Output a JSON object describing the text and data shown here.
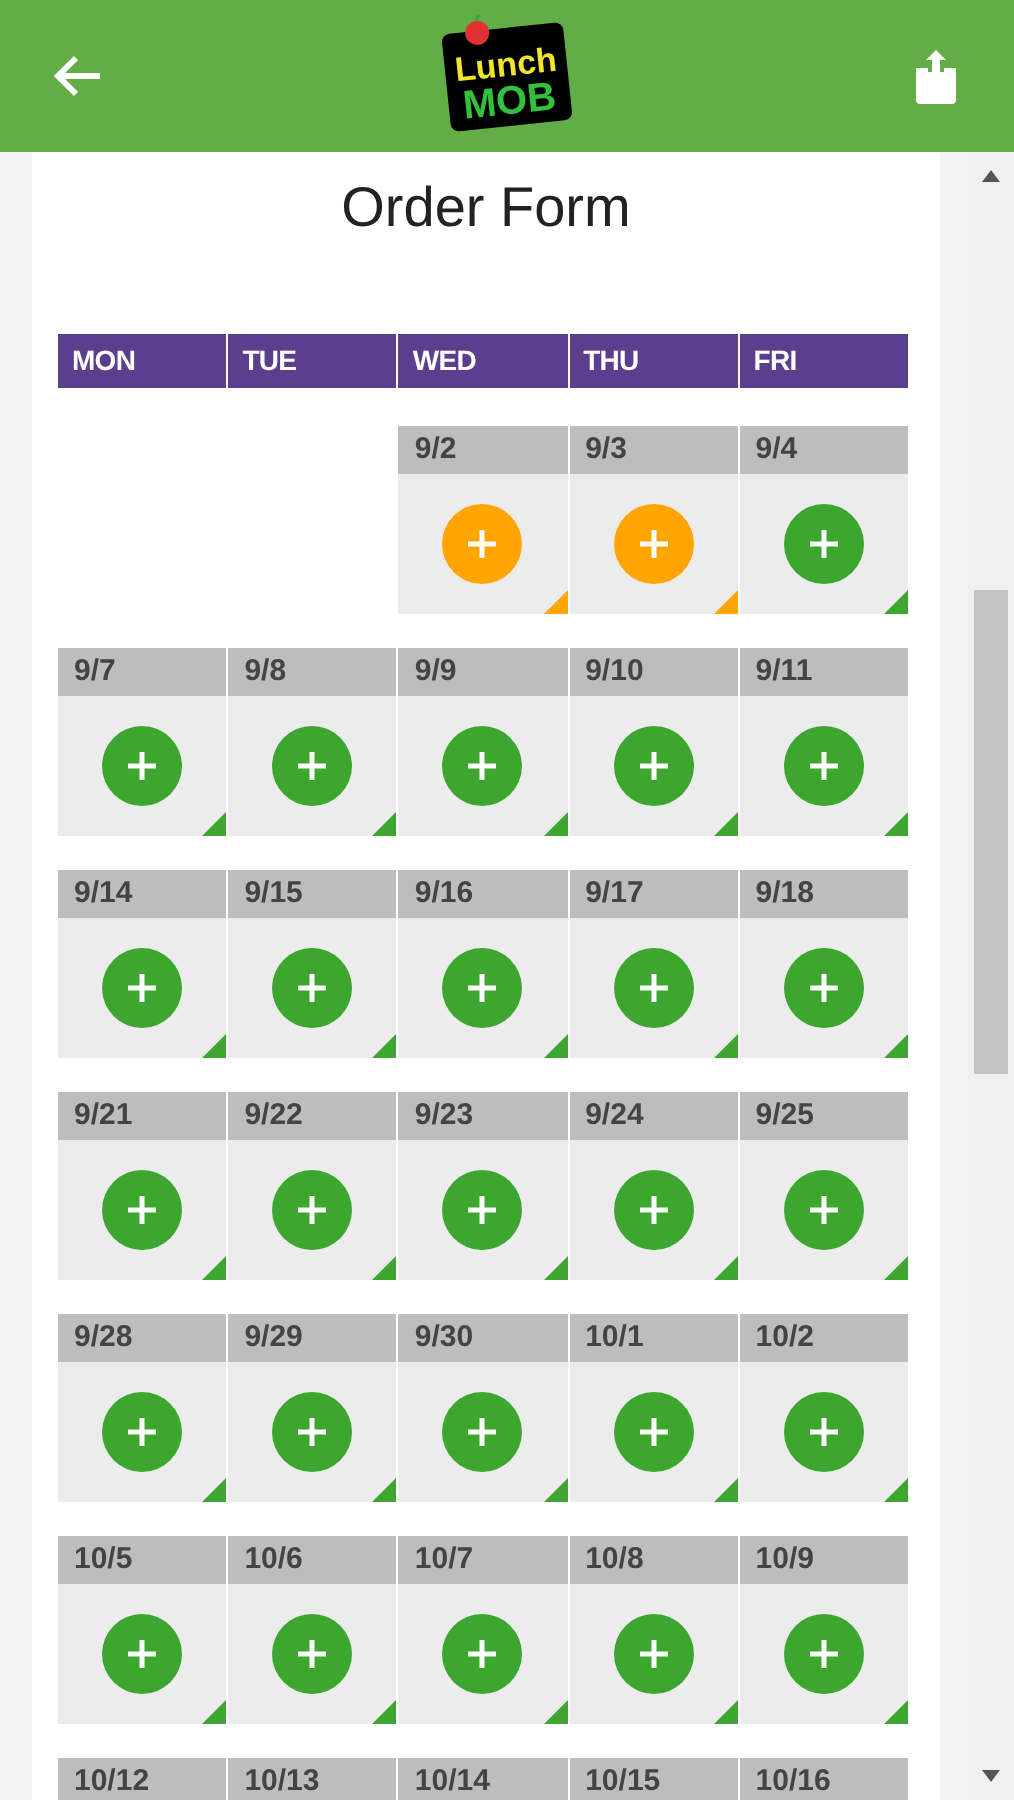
{
  "header": {
    "logo_top": "Lunch",
    "logo_bottom": "MOB"
  },
  "title": "Order Form",
  "weekdays": [
    "MON",
    "TUE",
    "WED",
    "THU",
    "FRI"
  ],
  "weeks": [
    {
      "days": [
        {
          "kind": "empty"
        },
        {
          "kind": "empty"
        },
        {
          "kind": "day",
          "date": "9/2",
          "color": "#ffa500"
        },
        {
          "kind": "day",
          "date": "9/3",
          "color": "#ffa500"
        },
        {
          "kind": "day",
          "date": "9/4",
          "color": "#3da62e"
        }
      ]
    },
    {
      "days": [
        {
          "kind": "day",
          "date": "9/7",
          "color": "#3da62e"
        },
        {
          "kind": "day",
          "date": "9/8",
          "color": "#3da62e"
        },
        {
          "kind": "day",
          "date": "9/9",
          "color": "#3da62e"
        },
        {
          "kind": "day",
          "date": "9/10",
          "color": "#3da62e"
        },
        {
          "kind": "day",
          "date": "9/11",
          "color": "#3da62e"
        }
      ]
    },
    {
      "days": [
        {
          "kind": "day",
          "date": "9/14",
          "color": "#3da62e"
        },
        {
          "kind": "day",
          "date": "9/15",
          "color": "#3da62e"
        },
        {
          "kind": "day",
          "date": "9/16",
          "color": "#3da62e"
        },
        {
          "kind": "day",
          "date": "9/17",
          "color": "#3da62e"
        },
        {
          "kind": "day",
          "date": "9/18",
          "color": "#3da62e"
        }
      ]
    },
    {
      "days": [
        {
          "kind": "day",
          "date": "9/21",
          "color": "#3da62e"
        },
        {
          "kind": "day",
          "date": "9/22",
          "color": "#3da62e"
        },
        {
          "kind": "day",
          "date": "9/23",
          "color": "#3da62e"
        },
        {
          "kind": "day",
          "date": "9/24",
          "color": "#3da62e"
        },
        {
          "kind": "day",
          "date": "9/25",
          "color": "#3da62e"
        }
      ]
    },
    {
      "days": [
        {
          "kind": "day",
          "date": "9/28",
          "color": "#3da62e"
        },
        {
          "kind": "day",
          "date": "9/29",
          "color": "#3da62e"
        },
        {
          "kind": "day",
          "date": "9/30",
          "color": "#3da62e"
        },
        {
          "kind": "day",
          "date": "10/1",
          "color": "#3da62e"
        },
        {
          "kind": "day",
          "date": "10/2",
          "color": "#3da62e"
        }
      ]
    },
    {
      "days": [
        {
          "kind": "day",
          "date": "10/5",
          "color": "#3da62e"
        },
        {
          "kind": "day",
          "date": "10/6",
          "color": "#3da62e"
        },
        {
          "kind": "day",
          "date": "10/7",
          "color": "#3da62e"
        },
        {
          "kind": "day",
          "date": "10/8",
          "color": "#3da62e"
        },
        {
          "kind": "day",
          "date": "10/9",
          "color": "#3da62e"
        }
      ]
    },
    {
      "days": [
        {
          "kind": "day",
          "date": "10/12"
        },
        {
          "kind": "day",
          "date": "10/13"
        },
        {
          "kind": "day",
          "date": "10/14"
        },
        {
          "kind": "day",
          "date": "10/15"
        },
        {
          "kind": "day",
          "date": "10/16"
        }
      ]
    }
  ]
}
